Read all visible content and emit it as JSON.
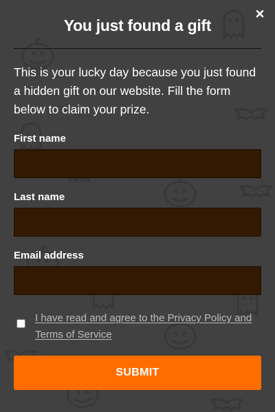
{
  "modal": {
    "title": "You just found a gift",
    "intro": "This is your lucky day because you just found a hidden gift on our website. Fill the form below to claim your prize.",
    "close_icon": "close-icon",
    "background_color": "#414141",
    "pattern_icons": [
      "pumpkin-icon",
      "ghost-icon",
      "bat-icon"
    ]
  },
  "form": {
    "first_name": {
      "label": "First name",
      "value": "",
      "placeholder": ""
    },
    "last_name": {
      "label": "Last name",
      "value": "",
      "placeholder": ""
    },
    "email": {
      "label": "Email address",
      "value": "",
      "placeholder": ""
    },
    "consent_text": "I have read and agree to the Privacy Policy and Terms of Service",
    "submit_label": "SUBMIT"
  },
  "colors": {
    "accent": "#ff6d00",
    "input_bg": "#331900",
    "text": "#ffffff"
  }
}
